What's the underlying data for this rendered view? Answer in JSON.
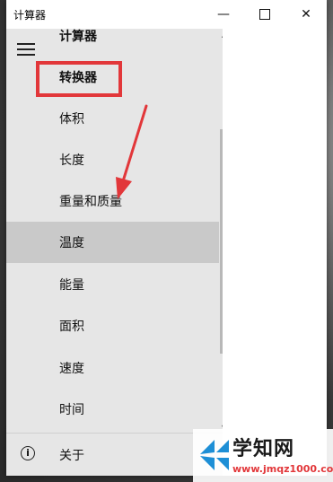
{
  "window": {
    "title": "计算器",
    "min_glyph": "—",
    "close_glyph": "✕"
  },
  "nav": {
    "header": "计算器",
    "items": [
      {
        "label": "转换器"
      },
      {
        "label": "体积"
      },
      {
        "label": "长度"
      },
      {
        "label": "重量和质量"
      },
      {
        "label": "温度"
      },
      {
        "label": "能量"
      },
      {
        "label": "面积"
      },
      {
        "label": "速度"
      },
      {
        "label": "时间"
      }
    ],
    "selected_index": 4,
    "footer": {
      "label": "关于",
      "icon": "info-icon",
      "icon_glyph": "i"
    }
  },
  "annotation": {
    "highlight_color": "#e2373a"
  },
  "scroll": {
    "up_glyph": "▲",
    "down_glyph": "▼"
  },
  "watermark": {
    "title": "学知网",
    "url": "www.jmqz1000.com"
  }
}
